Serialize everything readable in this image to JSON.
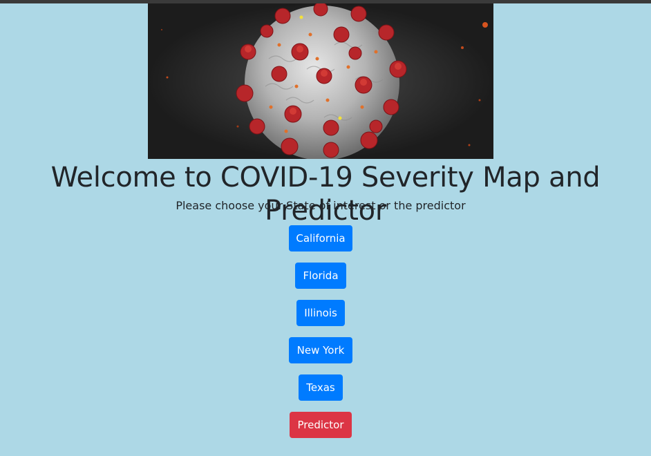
{
  "hero": {
    "image": "coronavirus-illustration"
  },
  "heading": "Welcome to COVID-19 Severity Map and Predictor",
  "subheading": "Please choose your State of interest or the predictor",
  "buttons": {
    "california": "California",
    "florida": "Florida",
    "illinois": "Illinois",
    "new_york": "New York",
    "texas": "Texas",
    "predictor": "Predictor"
  },
  "colors": {
    "background": "#add8e6",
    "primary": "#007bff",
    "danger": "#dc3545",
    "text": "#212529"
  }
}
